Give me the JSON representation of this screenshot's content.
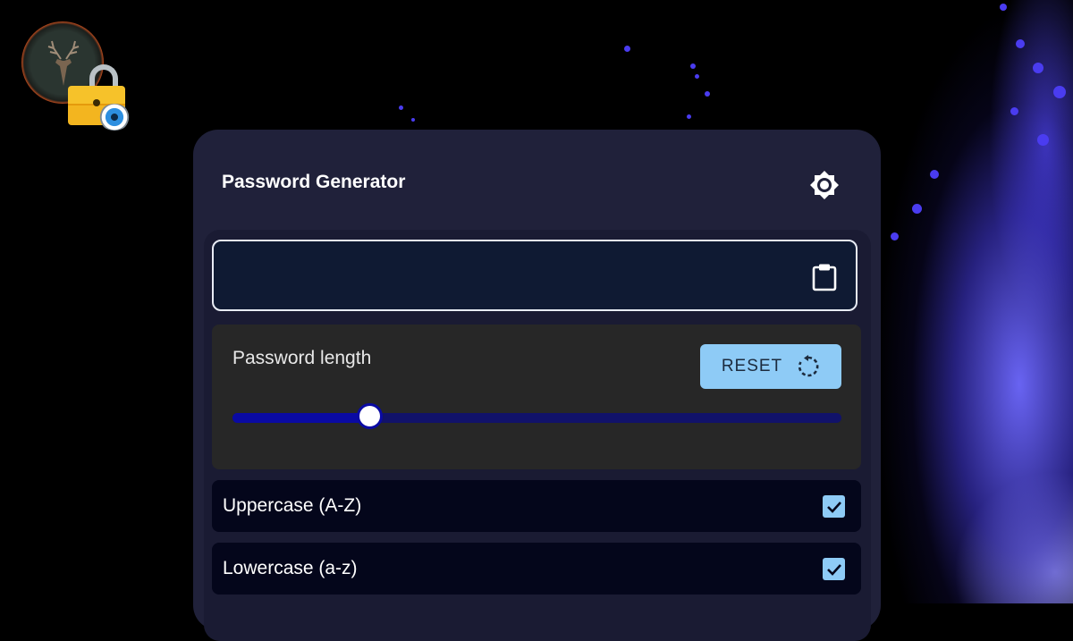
{
  "app": {
    "title": "Password Generator",
    "accent_color": "#8ecbf6",
    "slider_color": "#0a0aa3"
  },
  "password_field": {
    "value": "",
    "copy_icon": "clipboard-icon"
  },
  "header": {
    "theme_icon": "brightness-icon"
  },
  "length": {
    "label": "Password length",
    "reset_label": "RESET",
    "reset_icon": "refresh-icon",
    "slider_fraction": 0.225
  },
  "options": [
    {
      "label": "Uppercase (A-Z)",
      "checked": true
    },
    {
      "label": "Lowercase (a-z)",
      "checked": true
    }
  ]
}
